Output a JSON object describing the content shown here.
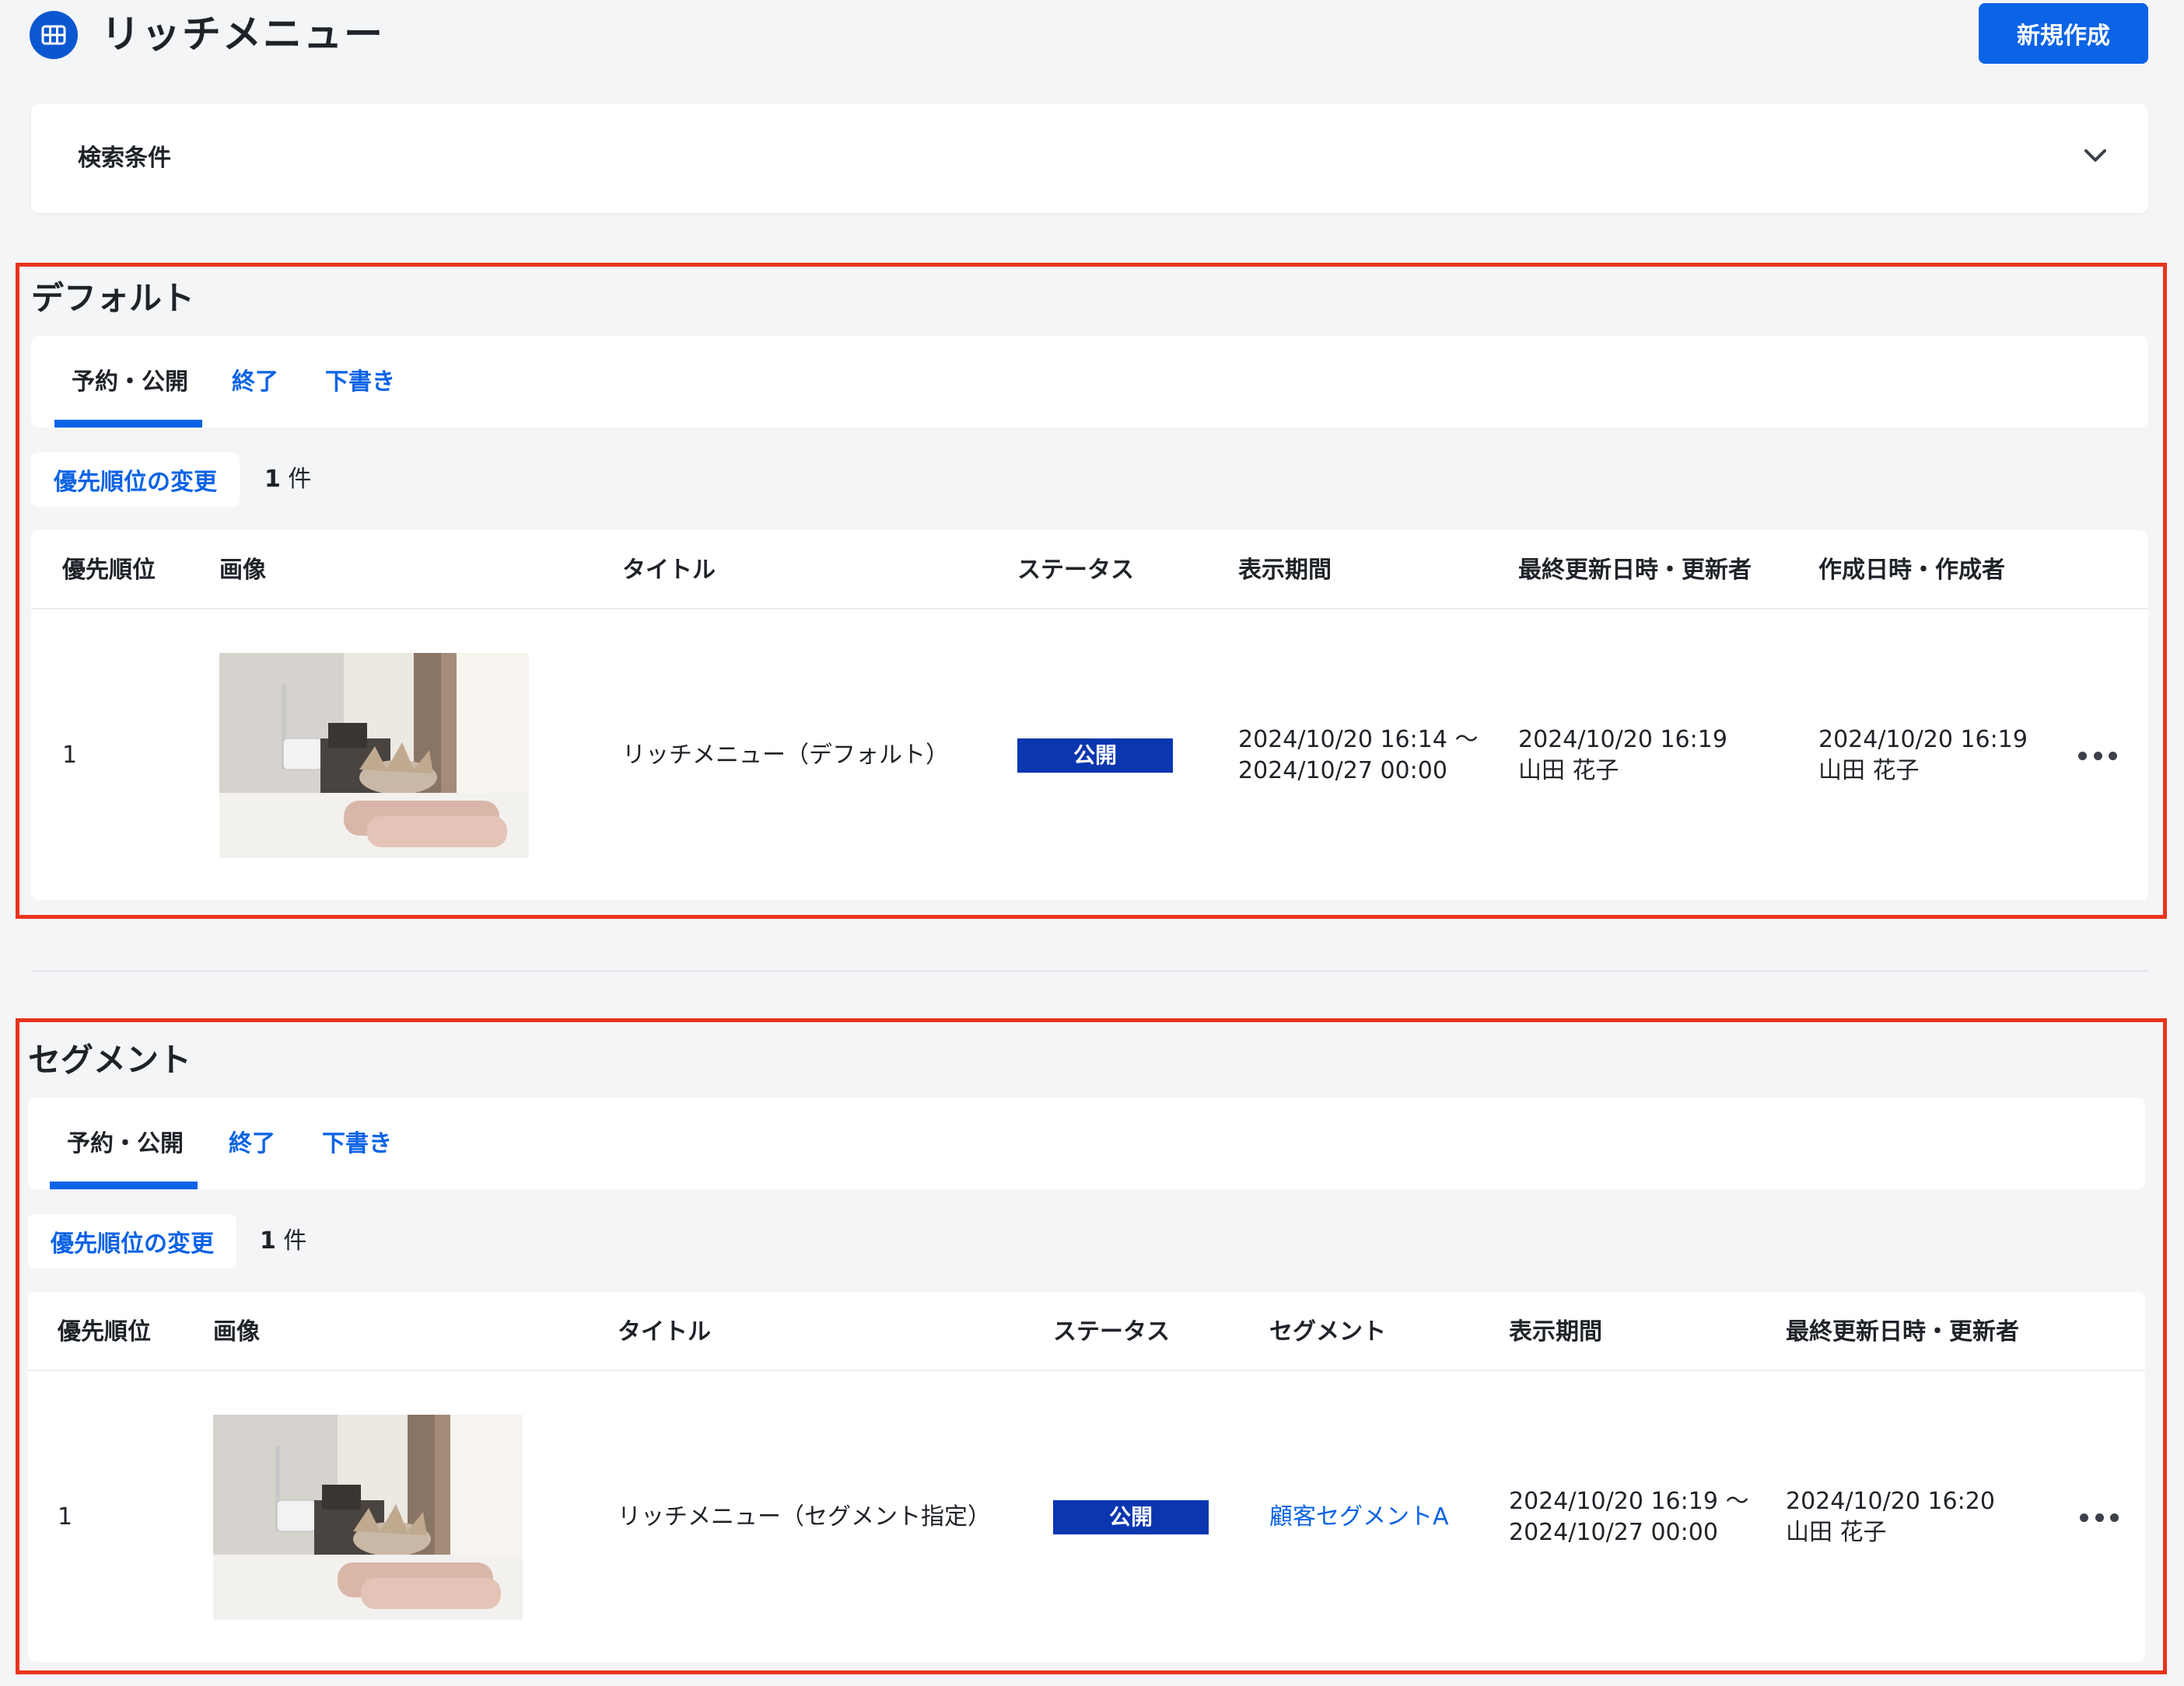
{
  "header": {
    "title": "リッチメニュー",
    "icon": "grid-icon",
    "new_button_label": "新規作成"
  },
  "search": {
    "label": "検索条件",
    "toggle_icon": "chevron-down-icon"
  },
  "colors": {
    "accent": "#0b63e5",
    "badge": "#0a36b0",
    "highlight_frame": "#e8341c"
  },
  "default_section": {
    "title": "デフォルト",
    "tabs": [
      {
        "label": "予約・公開",
        "active": true
      },
      {
        "label": "終了",
        "active": false
      },
      {
        "label": "下書き",
        "active": false
      }
    ],
    "priority_button_label": "優先順位の変更",
    "count_number": "1",
    "count_unit": "件",
    "columns": [
      "優先順位",
      "画像",
      "タイトル",
      "ステータス",
      "表示期間",
      "最終更新日時・更新者",
      "作成日時・作成者"
    ],
    "rows": [
      {
        "priority": "1",
        "title": "リッチメニュー（デフォルト）",
        "status": "公開",
        "period_start": "2024/10/20 16:14 〜",
        "period_end": "2024/10/27 00:00",
        "updated_at": "2024/10/20 16:19",
        "updated_by": "山田 花子",
        "created_at": "2024/10/20 16:19",
        "created_by": "山田 花子"
      }
    ]
  },
  "segment_section": {
    "title": "セグメント",
    "tabs": [
      {
        "label": "予約・公開",
        "active": true
      },
      {
        "label": "終了",
        "active": false
      },
      {
        "label": "下書き",
        "active": false
      }
    ],
    "priority_button_label": "優先順位の変更",
    "count_number": "1",
    "count_unit": "件",
    "columns": [
      "優先順位",
      "画像",
      "タイトル",
      "ステータス",
      "セグメント",
      "表示期間",
      "最終更新日時・更新者"
    ],
    "rows": [
      {
        "priority": "1",
        "title": "リッチメニュー（セグメント指定）",
        "status": "公開",
        "segment": "顧客セグメントA",
        "period_start": "2024/10/20 16:19 〜",
        "period_end": "2024/10/27 00:00",
        "updated_at": "2024/10/20 16:20",
        "updated_by": "山田 花子"
      }
    ]
  }
}
